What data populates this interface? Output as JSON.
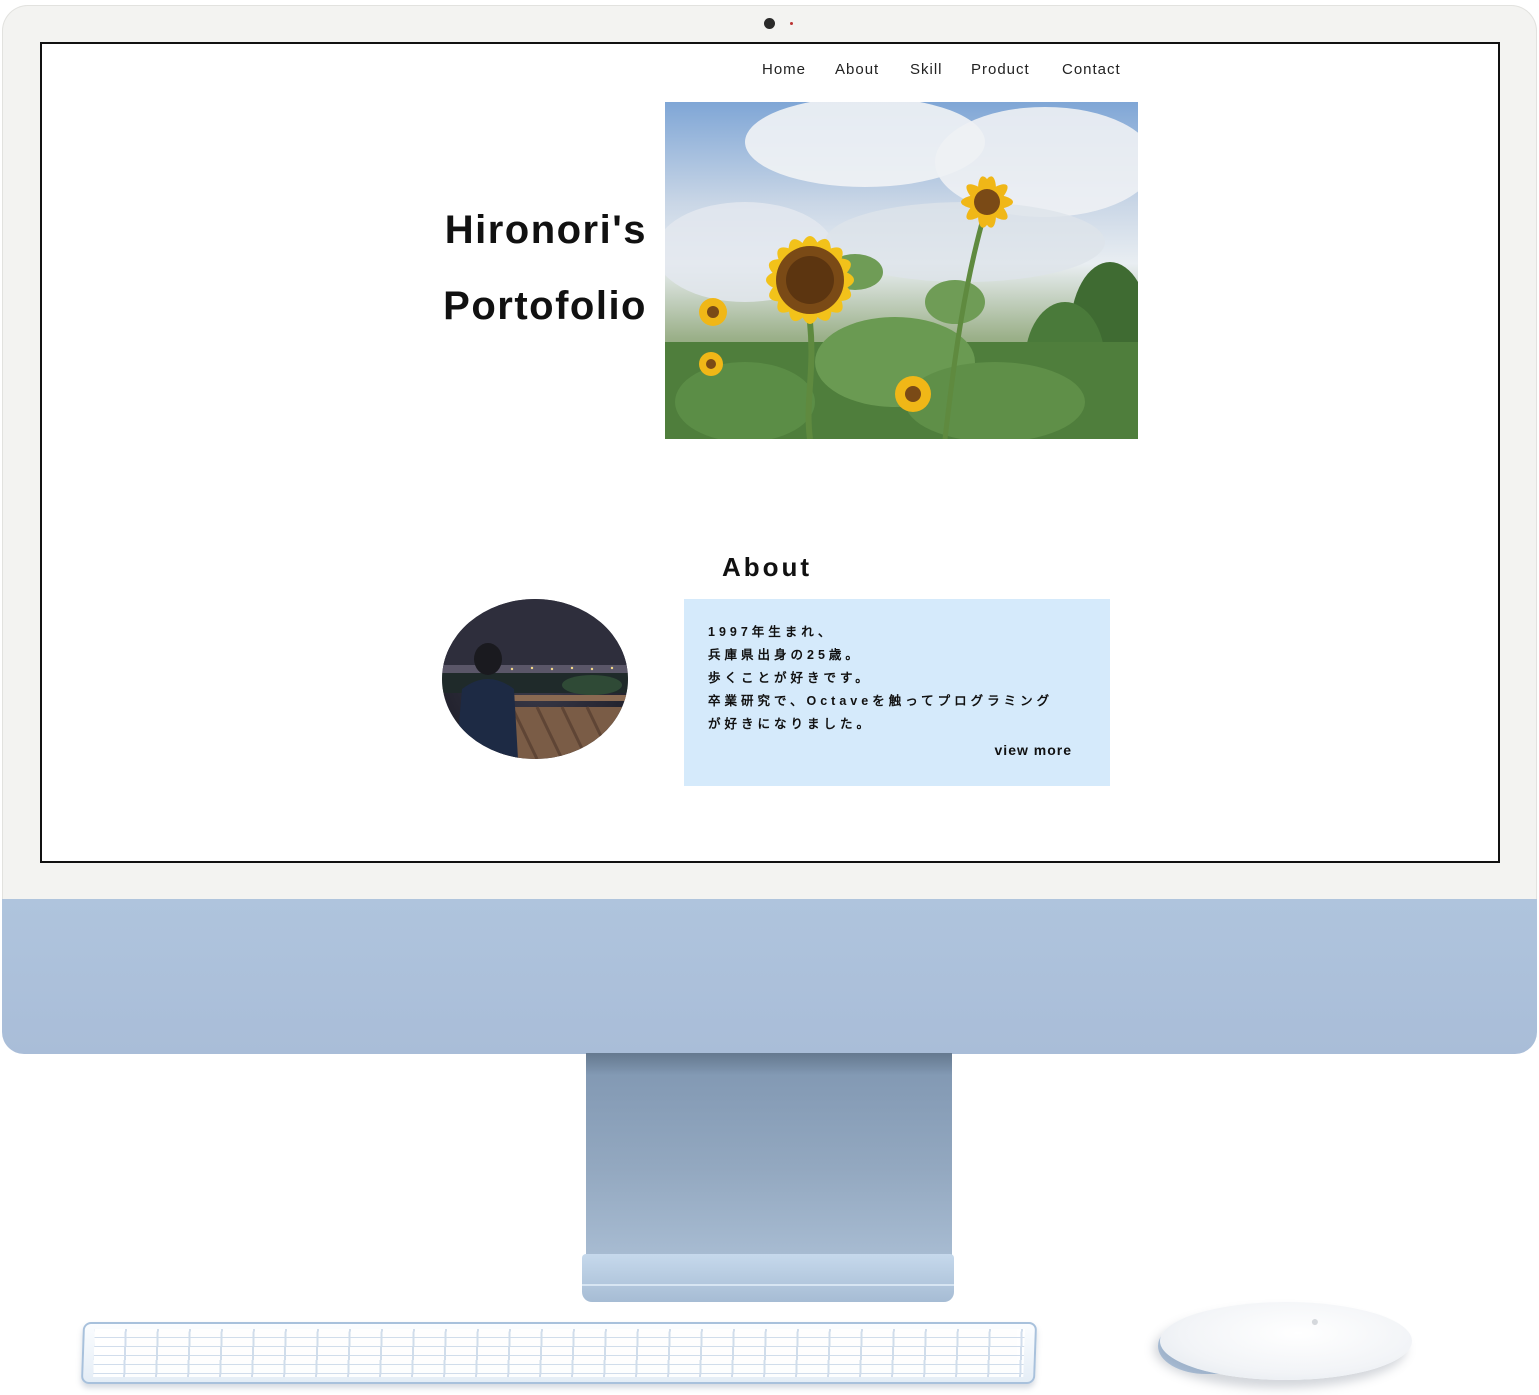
{
  "nav": {
    "items": [
      {
        "label": "Home"
      },
      {
        "label": "About"
      },
      {
        "label": "Skill"
      },
      {
        "label": "Product"
      },
      {
        "label": "Contact"
      }
    ]
  },
  "hero": {
    "title_line1": "Hironori's",
    "title_line2": "Portofolio",
    "photo_subject": "sunflower-field"
  },
  "about": {
    "heading": "About",
    "avatar_subject": "person-night-view",
    "lines": [
      "1997年生まれ、",
      "兵庫県出身の25歳。",
      "歩くことが好きです。",
      "卒業研究で、Octaveを触ってプログラミング",
      "が好きになりました。"
    ],
    "view_more": "view more"
  },
  "colors": {
    "about_card_bg": "#d5eafb",
    "device_chin": "#afc4dd",
    "text": "#111111"
  }
}
